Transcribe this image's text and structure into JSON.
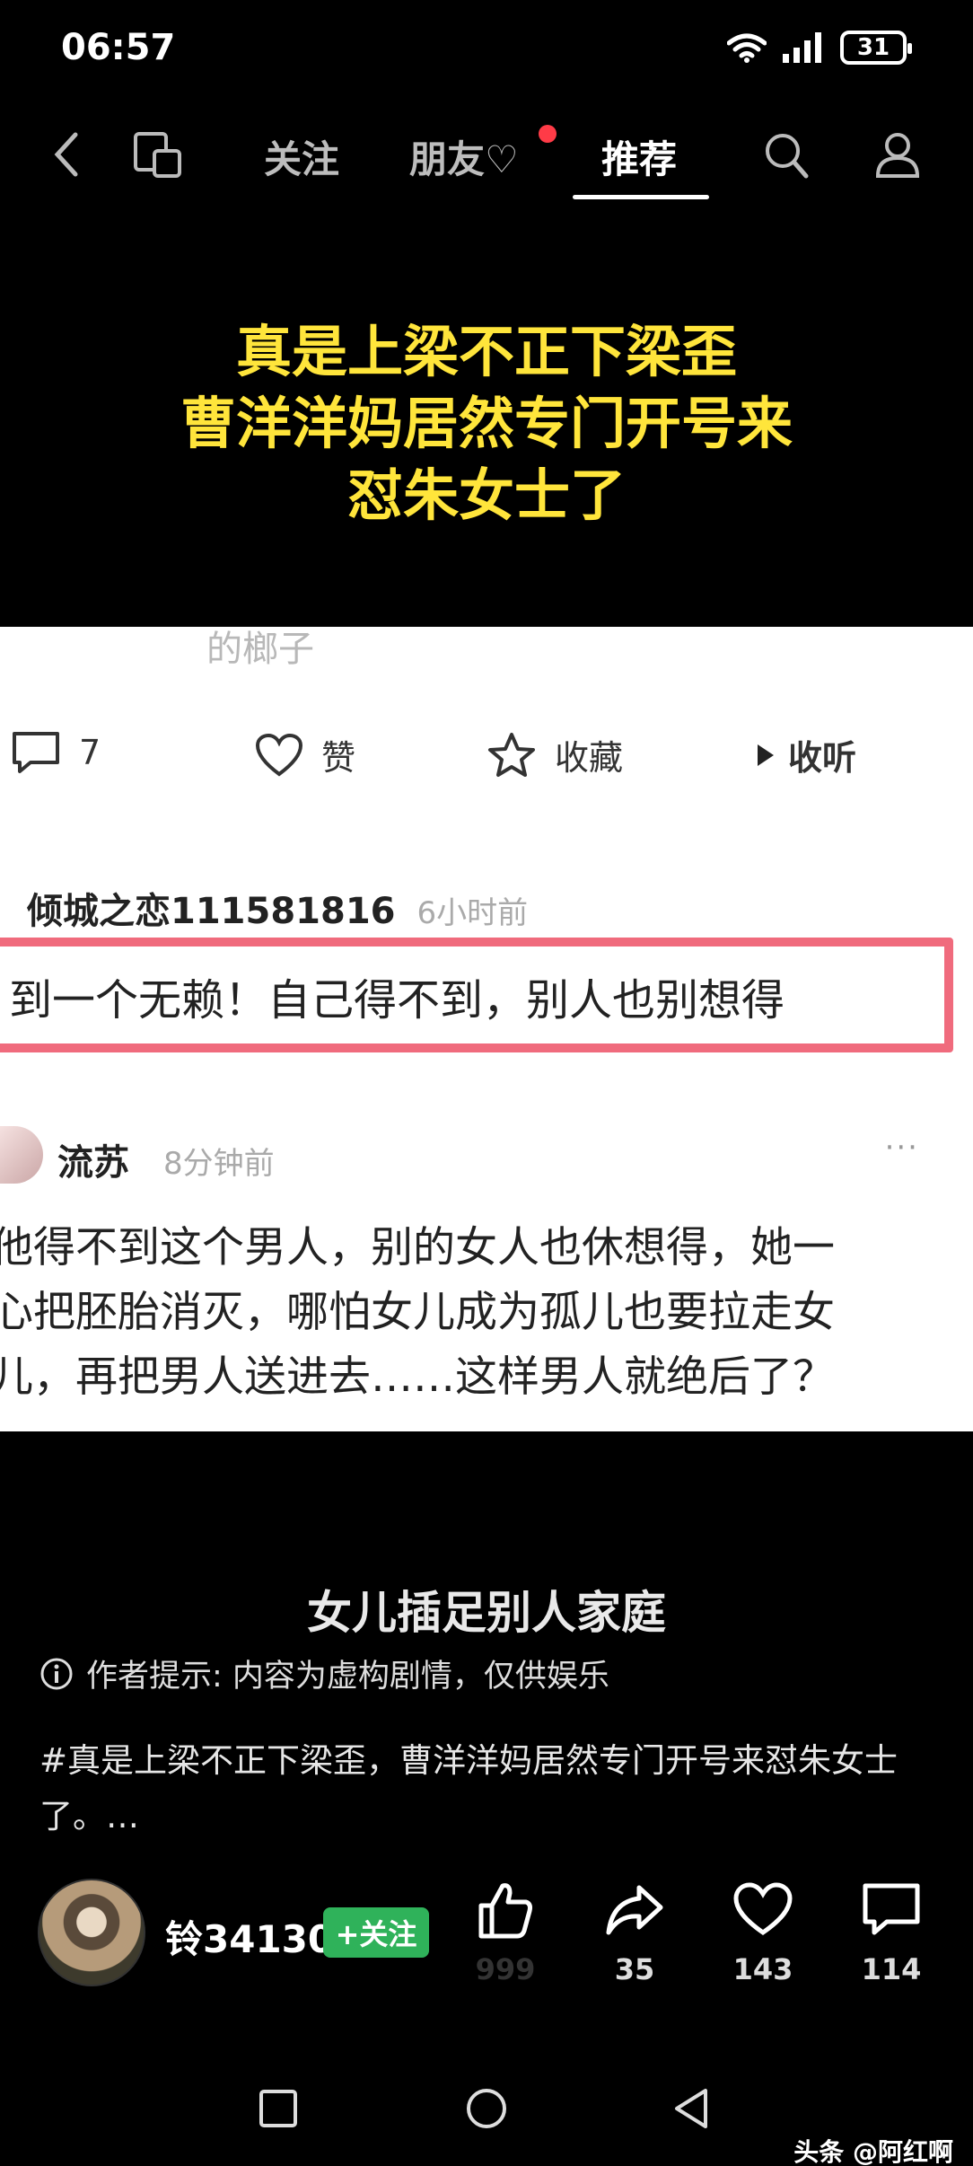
{
  "status_bar": {
    "time": "06:57",
    "battery": "31"
  },
  "nav": {
    "tabs": [
      {
        "label": "关注"
      },
      {
        "label": "朋友♡"
      },
      {
        "label": "推荐"
      }
    ]
  },
  "headline": {
    "line1": "真是上梁不正下梁歪",
    "line2": "曹洋洋妈居然专门开号来",
    "line3": "怼朱女士了"
  },
  "panel": {
    "faded_text": "的榔子",
    "actions": {
      "comment_count": "7",
      "like_label": "赞",
      "collect_label": "收藏",
      "listen_label": "收听"
    },
    "comment1": {
      "name": "倾城之恋111581816",
      "time": "6小时前",
      "text": "到一个无赖！自己得不到，别人也别想得"
    },
    "comment2": {
      "name": "流苏",
      "time": "8分钟前",
      "more": "···",
      "text": "他得不到这个男人，别的女人也休想得，她一\n心把胚胎消灭，哪怕女儿成为孤儿也要拉走女\n儿，再把男人送进去……这样男人就绝后了？"
    }
  },
  "video": {
    "title": "女儿插足别人家庭",
    "tip": "作者提示: 内容为虚构剧情，仅供娱乐",
    "description": "#真是上梁不正下梁歪，曹洋洋妈居然专门开号来怼朱女士了。…"
  },
  "author": {
    "name": "铃34130",
    "follow_label": "+关注",
    "stats": {
      "likes": "999",
      "shares": "35",
      "favorites": "143",
      "comments": "114"
    }
  },
  "watermark": "头条 @阿红啊",
  "colors": {
    "headline": "#ffe53b",
    "highlight_border": "#f06b7d",
    "follow_button": "#2fb25a",
    "notification_dot": "#ff3b47"
  }
}
